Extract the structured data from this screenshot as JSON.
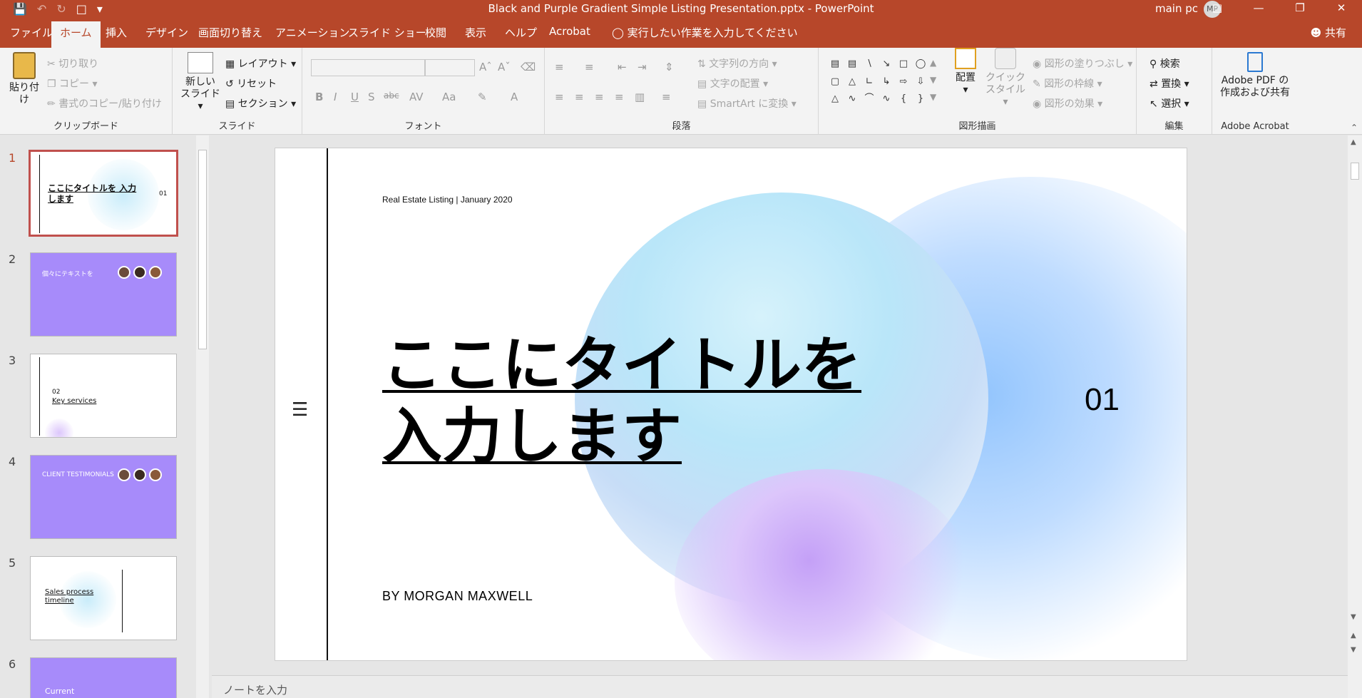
{
  "titlebar": {
    "title": "Black and Purple Gradient Simple Listing Presentation.pptx  -  PowerPoint",
    "user": "main pc",
    "initials": "MP"
  },
  "tabs": [
    "ファイル",
    "ホーム",
    "挿入",
    "デザイン",
    "画面切り替え",
    "アニメーション",
    "スライド ショー",
    "校閲",
    "表示",
    "ヘルプ",
    "Acrobat"
  ],
  "active_tab": "ホーム",
  "tell_me": "実行したい作業を入力してください",
  "share": "共有",
  "ribbon": {
    "clipboard": {
      "label": "クリップボード",
      "paste": "貼り付け",
      "cut": "切り取り",
      "copy": "コピー",
      "format_painter": "書式のコピー/貼り付け"
    },
    "slides": {
      "label": "スライド",
      "new_slide": "新しい",
      "new_slide2": "スライド",
      "layout": "レイアウト",
      "reset": "リセット",
      "section": "セクション"
    },
    "font": {
      "label": "フォント"
    },
    "paragraph": {
      "label": "段落",
      "text_direction": "文字列の方向",
      "align_text": "文字の配置",
      "smartart": "SmartArt に変換"
    },
    "drawing": {
      "label": "図形描画",
      "arrange": "配置",
      "quick_styles": "クイック",
      "quick_styles2": "スタイル",
      "fill": "図形の塗りつぶし",
      "outline": "図形の枠線",
      "effects": "図形の効果"
    },
    "editing": {
      "label": "編集",
      "find": "検索",
      "replace": "置換",
      "select": "選択"
    },
    "acrobat": {
      "label": "Adobe Acrobat",
      "btn1": "Adobe PDF の",
      "btn2": "作成および共有"
    }
  },
  "thumbnails": [
    {
      "num": "1",
      "title": "ここにタイトルを 入力します",
      "number": "01"
    },
    {
      "num": "2",
      "title": "個々にテキストを"
    },
    {
      "num": "3",
      "title": "Key services",
      "number": "02"
    },
    {
      "num": "4",
      "title": "CLIENT TESTIMONIALS"
    },
    {
      "num": "5",
      "title": "Sales process timeline"
    },
    {
      "num": "6",
      "title": "Current"
    }
  ],
  "slide": {
    "top_text": "Real Estate Listing | January 2020",
    "title_line1": "ここにタイトルを",
    "title_line2": "入力します",
    "number": "01",
    "byline": "BY MORGAN MAXWELL"
  },
  "notes_placeholder": "ノートを入力",
  "colors": {
    "accent": "#b7472a",
    "purple": "#a78bfa",
    "sky": "#b9e6f9",
    "blue": "#93c5fd"
  }
}
